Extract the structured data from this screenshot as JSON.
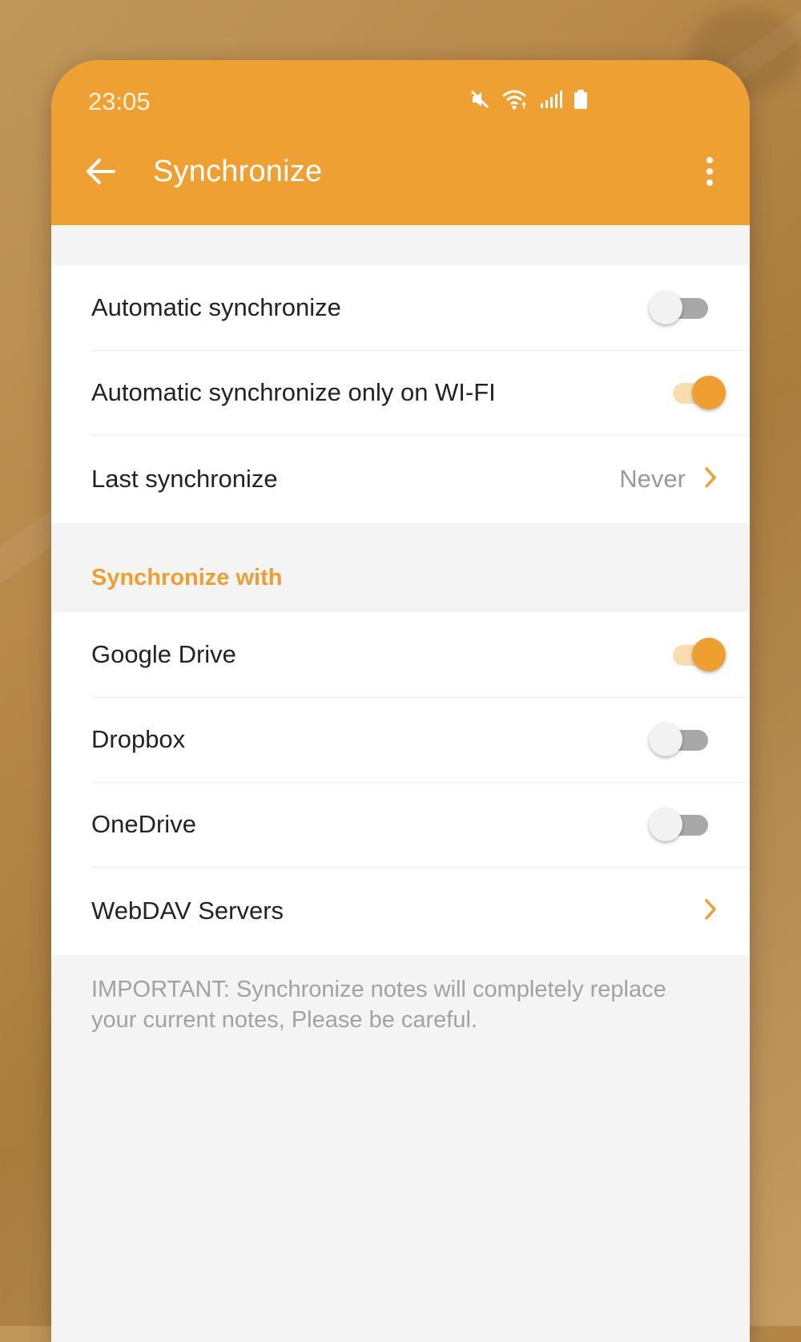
{
  "status_bar": {
    "time": "23:05",
    "icons": [
      "mute-icon",
      "wifi-icon",
      "signal-icon",
      "battery-icon"
    ]
  },
  "app_bar": {
    "title": "Synchronize",
    "back_icon": "arrow-left-icon",
    "menu_icon": "more-vertical-icon"
  },
  "colors": {
    "accent": "#efa032",
    "background": "#f4f4f4",
    "switch_on_track": "#f9ddb1",
    "switch_off_track": "#a8a8a8"
  },
  "settings": {
    "automatic": {
      "label": "Automatic synchronize",
      "enabled": false
    },
    "wifi_only": {
      "label": "Automatic synchronize only on WI-FI",
      "enabled": true
    },
    "last_sync": {
      "label": "Last synchronize",
      "value": "Never"
    }
  },
  "sync_with": {
    "header": "Synchronize with",
    "google_drive": {
      "label": "Google Drive",
      "enabled": true
    },
    "dropbox": {
      "label": "Dropbox",
      "enabled": false
    },
    "onedrive": {
      "label": "OneDrive",
      "enabled": false
    },
    "webdav": {
      "label": "WebDAV Servers"
    }
  },
  "note": "IMPORTANT: Synchronize notes will completely replace your current notes, Please be careful."
}
